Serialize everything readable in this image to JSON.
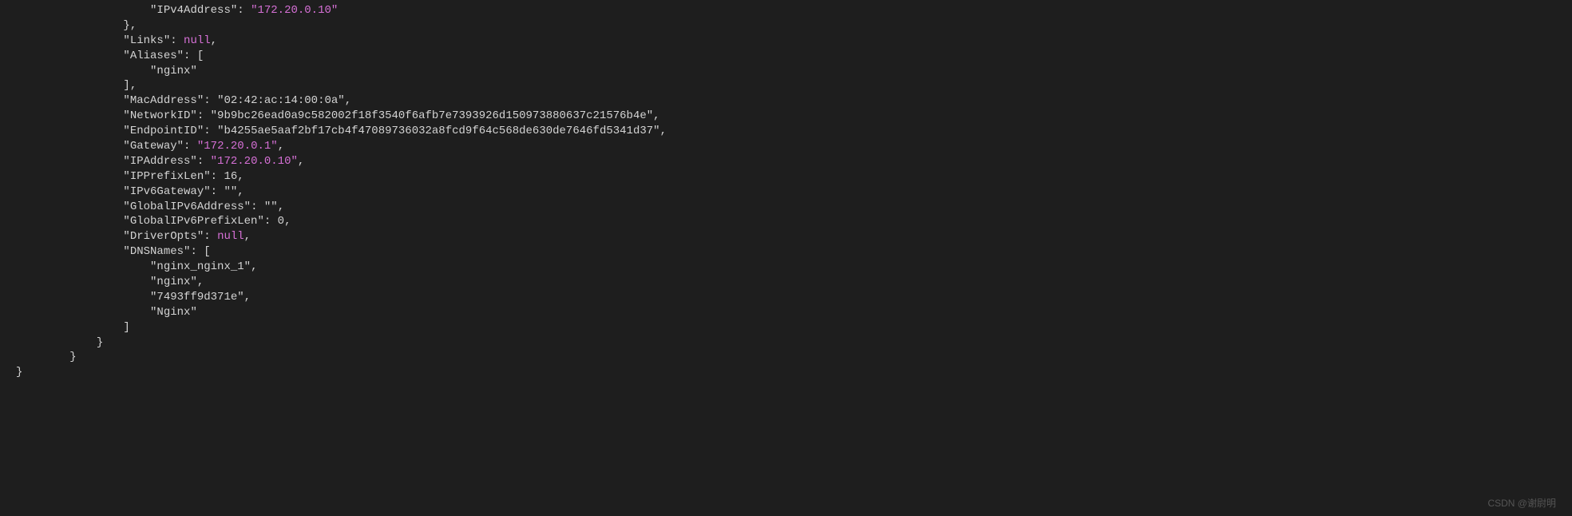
{
  "code": {
    "indent0": "",
    "indent1": "    ",
    "indent2": "        ",
    "indent3": "            ",
    "indent4": "                ",
    "indent5": "                    ",
    "line1_key": "\"IPv4Address\"",
    "line1_val": "\"172.20.0.10\"",
    "line2": "},",
    "line3_key": "\"Links\"",
    "line3_val": "null",
    "line4_key": "\"Aliases\"",
    "line5_val": "\"nginx\"",
    "line6": "],",
    "line7_key": "\"MacAddress\"",
    "line7_val": "\"02:42:ac:14:00:0a\"",
    "line8_key": "\"NetworkID\"",
    "line8_val": "\"9b9bc26ead0a9c582002f18f3540f6afb7e7393926d150973880637c21576b4e\"",
    "line9_key": "\"EndpointID\"",
    "line9_val": "\"b4255ae5aaf2bf17cb4f47089736032a8fcd9f64c568de630de7646fd5341d37\"",
    "line10_key": "\"Gateway\"",
    "line10_val": "\"172.20.0.1\"",
    "line11_key": "\"IPAddress\"",
    "line11_val": "\"172.20.0.10\"",
    "line12_key": "\"IPPrefixLen\"",
    "line12_val": "16",
    "line13_key": "\"IPv6Gateway\"",
    "line13_val": "\"\"",
    "line14_key": "\"GlobalIPv6Address\"",
    "line14_val": "\"\"",
    "line15_key": "\"GlobalIPv6PrefixLen\"",
    "line15_val": "0",
    "line16_key": "\"DriverOpts\"",
    "line16_val": "null",
    "line17_key": "\"DNSNames\"",
    "line18_val": "\"nginx_nginx_1\"",
    "line19_val": "\"nginx\"",
    "line20_val": "\"7493ff9d371e\"",
    "line21_val": "\"Nginx\"",
    "line22": "]",
    "line23": "}",
    "line24": "}",
    "line25": "}",
    "colon": ": ",
    "comma": ",",
    "lbracket": ": ["
  },
  "watermark": "CSDN @谢尉明"
}
